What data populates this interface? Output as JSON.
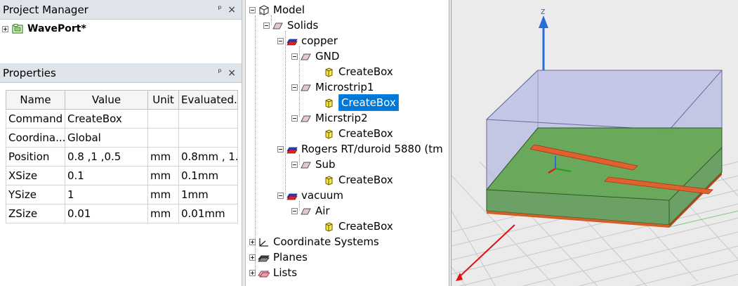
{
  "project_manager": {
    "title": "Project Manager",
    "pin": "ᵖ",
    "close": "×",
    "item": "WavePort*"
  },
  "properties": {
    "title": "Properties",
    "pin": "ᵖ",
    "close": "×",
    "columns": [
      "Name",
      "Value",
      "Unit",
      "Evaluated.."
    ],
    "rows": [
      [
        "Command",
        "CreateBox",
        "",
        ""
      ],
      [
        "Coordina...",
        "Global",
        "",
        ""
      ],
      [
        "Position",
        "0.8 ,1 ,0.5",
        "mm",
        "0.8mm , 1.."
      ],
      [
        "XSize",
        "0.1",
        "mm",
        "0.1mm"
      ],
      [
        "YSize",
        "1",
        "mm",
        "1mm"
      ],
      [
        "ZSize",
        "0.01",
        "mm",
        "0.01mm"
      ]
    ]
  },
  "tree": {
    "model": "Model",
    "solids": "Solids",
    "copper": "copper",
    "gnd": "GND",
    "gnd_op": "CreateBox",
    "microstrip1": "Microstrip1",
    "microstrip1_op": "CreateBox",
    "micrstrip2": "Micrstrip2",
    "micrstrip2_op": "CreateBox",
    "rogers": "Rogers RT/duroid 5880 (tm",
    "sub": "Sub",
    "sub_op": "CreateBox",
    "vacuum": "vacuum",
    "air": "Air",
    "air_op": "CreateBox",
    "coordinate_systems": "Coordinate Systems",
    "planes": "Planes",
    "lists": "Lists"
  },
  "viewport": {
    "axis_label": "z",
    "colors": {
      "air_box": "#b4b8e0",
      "substrate": "#5c9a4f",
      "strip": "#e06030",
      "z_axis": "#2a6cd8",
      "x_axis": "#e01010",
      "y_axis": "#20a020"
    }
  }
}
